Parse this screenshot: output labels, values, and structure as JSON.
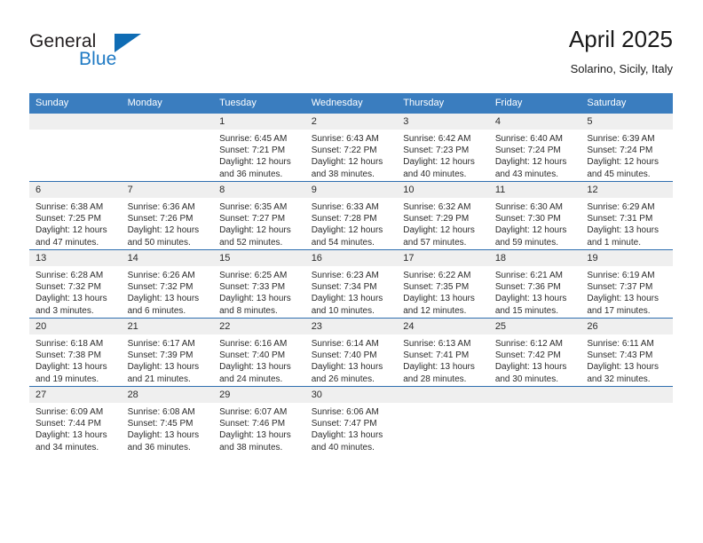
{
  "brand": {
    "name_part1": "General",
    "name_part2": "Blue",
    "triangle_icon": "triangle-icon",
    "accent_color": "#1f7ac4"
  },
  "header": {
    "title": "April 2025",
    "location": "Solarino, Sicily, Italy"
  },
  "theme": {
    "header_blue": "#3a7dbf",
    "week_divider_blue": "#2f6fb0",
    "daynum_band": "#efefef",
    "text": "#2b2b2b"
  },
  "weekday_headers": [
    "Sunday",
    "Monday",
    "Tuesday",
    "Wednesday",
    "Thursday",
    "Friday",
    "Saturday"
  ],
  "labels": {
    "sunrise_prefix": "Sunrise:",
    "sunset_prefix": "Sunset:",
    "daylight_prefix": "Daylight:"
  },
  "weeks": [
    [
      {
        "day": "",
        "sunrise": "",
        "sunset": "",
        "daylight": ""
      },
      {
        "day": "",
        "sunrise": "",
        "sunset": "",
        "daylight": ""
      },
      {
        "day": "1",
        "sunrise": "Sunrise: 6:45 AM",
        "sunset": "Sunset: 7:21 PM",
        "daylight": "Daylight: 12 hours and 36 minutes."
      },
      {
        "day": "2",
        "sunrise": "Sunrise: 6:43 AM",
        "sunset": "Sunset: 7:22 PM",
        "daylight": "Daylight: 12 hours and 38 minutes."
      },
      {
        "day": "3",
        "sunrise": "Sunrise: 6:42 AM",
        "sunset": "Sunset: 7:23 PM",
        "daylight": "Daylight: 12 hours and 40 minutes."
      },
      {
        "day": "4",
        "sunrise": "Sunrise: 6:40 AM",
        "sunset": "Sunset: 7:24 PM",
        "daylight": "Daylight: 12 hours and 43 minutes."
      },
      {
        "day": "5",
        "sunrise": "Sunrise: 6:39 AM",
        "sunset": "Sunset: 7:24 PM",
        "daylight": "Daylight: 12 hours and 45 minutes."
      }
    ],
    [
      {
        "day": "6",
        "sunrise": "Sunrise: 6:38 AM",
        "sunset": "Sunset: 7:25 PM",
        "daylight": "Daylight: 12 hours and 47 minutes."
      },
      {
        "day": "7",
        "sunrise": "Sunrise: 6:36 AM",
        "sunset": "Sunset: 7:26 PM",
        "daylight": "Daylight: 12 hours and 50 minutes."
      },
      {
        "day": "8",
        "sunrise": "Sunrise: 6:35 AM",
        "sunset": "Sunset: 7:27 PM",
        "daylight": "Daylight: 12 hours and 52 minutes."
      },
      {
        "day": "9",
        "sunrise": "Sunrise: 6:33 AM",
        "sunset": "Sunset: 7:28 PM",
        "daylight": "Daylight: 12 hours and 54 minutes."
      },
      {
        "day": "10",
        "sunrise": "Sunrise: 6:32 AM",
        "sunset": "Sunset: 7:29 PM",
        "daylight": "Daylight: 12 hours and 57 minutes."
      },
      {
        "day": "11",
        "sunrise": "Sunrise: 6:30 AM",
        "sunset": "Sunset: 7:30 PM",
        "daylight": "Daylight: 12 hours and 59 minutes."
      },
      {
        "day": "12",
        "sunrise": "Sunrise: 6:29 AM",
        "sunset": "Sunset: 7:31 PM",
        "daylight": "Daylight: 13 hours and 1 minute."
      }
    ],
    [
      {
        "day": "13",
        "sunrise": "Sunrise: 6:28 AM",
        "sunset": "Sunset: 7:32 PM",
        "daylight": "Daylight: 13 hours and 3 minutes."
      },
      {
        "day": "14",
        "sunrise": "Sunrise: 6:26 AM",
        "sunset": "Sunset: 7:32 PM",
        "daylight": "Daylight: 13 hours and 6 minutes."
      },
      {
        "day": "15",
        "sunrise": "Sunrise: 6:25 AM",
        "sunset": "Sunset: 7:33 PM",
        "daylight": "Daylight: 13 hours and 8 minutes."
      },
      {
        "day": "16",
        "sunrise": "Sunrise: 6:23 AM",
        "sunset": "Sunset: 7:34 PM",
        "daylight": "Daylight: 13 hours and 10 minutes."
      },
      {
        "day": "17",
        "sunrise": "Sunrise: 6:22 AM",
        "sunset": "Sunset: 7:35 PM",
        "daylight": "Daylight: 13 hours and 12 minutes."
      },
      {
        "day": "18",
        "sunrise": "Sunrise: 6:21 AM",
        "sunset": "Sunset: 7:36 PM",
        "daylight": "Daylight: 13 hours and 15 minutes."
      },
      {
        "day": "19",
        "sunrise": "Sunrise: 6:19 AM",
        "sunset": "Sunset: 7:37 PM",
        "daylight": "Daylight: 13 hours and 17 minutes."
      }
    ],
    [
      {
        "day": "20",
        "sunrise": "Sunrise: 6:18 AM",
        "sunset": "Sunset: 7:38 PM",
        "daylight": "Daylight: 13 hours and 19 minutes."
      },
      {
        "day": "21",
        "sunrise": "Sunrise: 6:17 AM",
        "sunset": "Sunset: 7:39 PM",
        "daylight": "Daylight: 13 hours and 21 minutes."
      },
      {
        "day": "22",
        "sunrise": "Sunrise: 6:16 AM",
        "sunset": "Sunset: 7:40 PM",
        "daylight": "Daylight: 13 hours and 24 minutes."
      },
      {
        "day": "23",
        "sunrise": "Sunrise: 6:14 AM",
        "sunset": "Sunset: 7:40 PM",
        "daylight": "Daylight: 13 hours and 26 minutes."
      },
      {
        "day": "24",
        "sunrise": "Sunrise: 6:13 AM",
        "sunset": "Sunset: 7:41 PM",
        "daylight": "Daylight: 13 hours and 28 minutes."
      },
      {
        "day": "25",
        "sunrise": "Sunrise: 6:12 AM",
        "sunset": "Sunset: 7:42 PM",
        "daylight": "Daylight: 13 hours and 30 minutes."
      },
      {
        "day": "26",
        "sunrise": "Sunrise: 6:11 AM",
        "sunset": "Sunset: 7:43 PM",
        "daylight": "Daylight: 13 hours and 32 minutes."
      }
    ],
    [
      {
        "day": "27",
        "sunrise": "Sunrise: 6:09 AM",
        "sunset": "Sunset: 7:44 PM",
        "daylight": "Daylight: 13 hours and 34 minutes."
      },
      {
        "day": "28",
        "sunrise": "Sunrise: 6:08 AM",
        "sunset": "Sunset: 7:45 PM",
        "daylight": "Daylight: 13 hours and 36 minutes."
      },
      {
        "day": "29",
        "sunrise": "Sunrise: 6:07 AM",
        "sunset": "Sunset: 7:46 PM",
        "daylight": "Daylight: 13 hours and 38 minutes."
      },
      {
        "day": "30",
        "sunrise": "Sunrise: 6:06 AM",
        "sunset": "Sunset: 7:47 PM",
        "daylight": "Daylight: 13 hours and 40 minutes."
      },
      {
        "day": "",
        "sunrise": "",
        "sunset": "",
        "daylight": ""
      },
      {
        "day": "",
        "sunrise": "",
        "sunset": "",
        "daylight": ""
      },
      {
        "day": "",
        "sunrise": "",
        "sunset": "",
        "daylight": ""
      }
    ]
  ]
}
